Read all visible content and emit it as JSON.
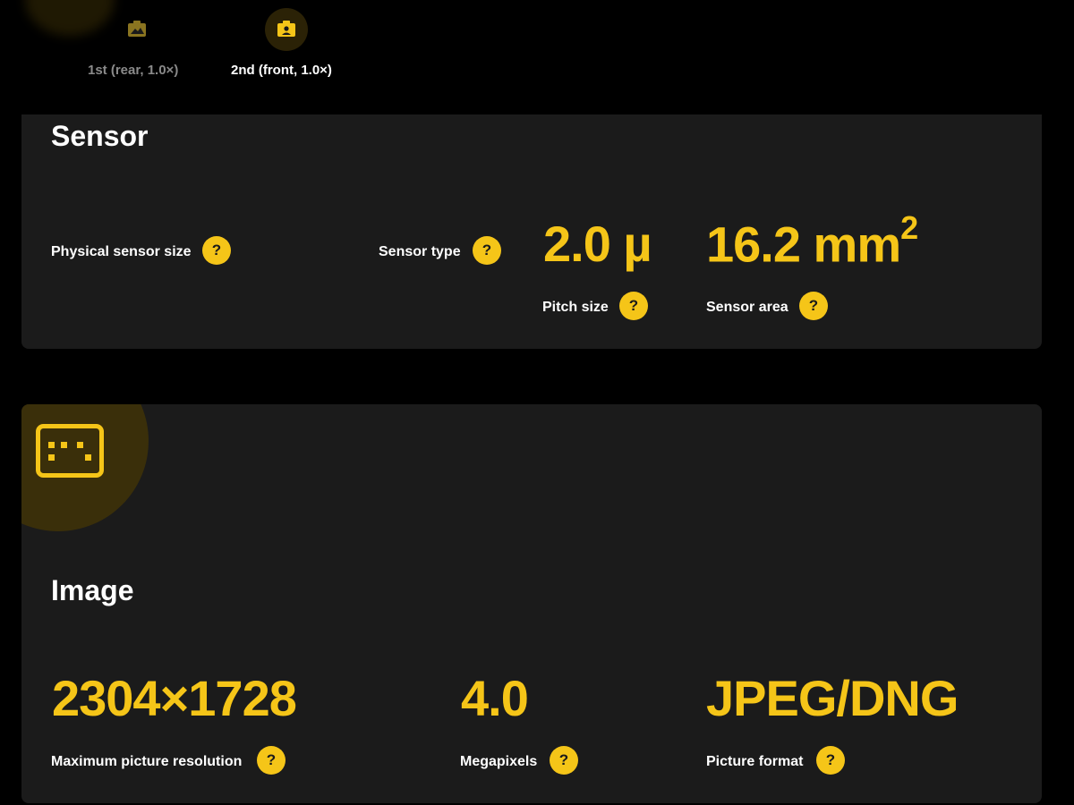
{
  "camera_tabs": [
    {
      "label": "1st (rear, 1.0×)",
      "icon": "camera-landscape-icon",
      "active": false
    },
    {
      "label": "2nd (front, 1.0×)",
      "icon": "camera-portrait-icon",
      "active": true
    }
  ],
  "sensor": {
    "title": "Sensor",
    "physical_size_label": "Physical sensor size",
    "type_label": "Sensor type",
    "pitch_value": "2.0 µ",
    "pitch_label": "Pitch size",
    "area_value": "16.2 mm",
    "area_unit_sup": "2",
    "area_label": "Sensor area"
  },
  "image": {
    "title": "Image",
    "icon": "image-grid-icon",
    "resolution_value": "2304×1728",
    "resolution_label": "Maximum picture resolution",
    "megapixels_value": "4.0",
    "megapixels_label": "Megapixels",
    "format_value": "JPEG/DNG",
    "format_label": "Picture format"
  },
  "help_glyph": "?",
  "colors": {
    "accent": "#f5c518",
    "card": "#1b1b1b",
    "background": "#000000"
  }
}
